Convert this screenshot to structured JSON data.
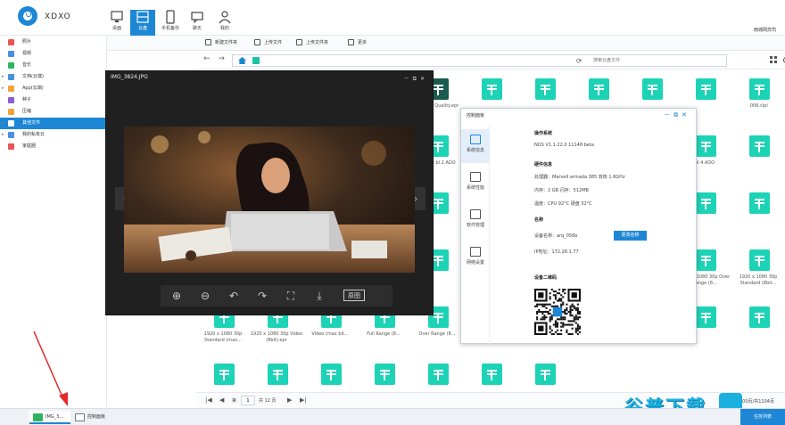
{
  "app": {
    "title": "XDXO",
    "user": "雨城网苏司"
  },
  "nav": [
    {
      "label": "桌面"
    },
    {
      "label": "云盘"
    },
    {
      "label": "手机备份"
    },
    {
      "label": "聊天"
    },
    {
      "label": "我的"
    }
  ],
  "sidebar": {
    "items": [
      {
        "label": "照片",
        "color": "#e95454",
        "arrow": ""
      },
      {
        "label": "视频",
        "color": "#4a8fe0",
        "arrow": ""
      },
      {
        "label": "音乐",
        "color": "#2fb560",
        "arrow": ""
      },
      {
        "label": "文档(云端)",
        "color": "#4a8fe0",
        "arrow": "▸"
      },
      {
        "label": "App(云端)",
        "color": "#f0a23b",
        "arrow": "▸"
      },
      {
        "label": "种子",
        "color": "#8e5cd9",
        "arrow": ""
      },
      {
        "label": "压缩",
        "color": "#f0a23b",
        "arrow": ""
      },
      {
        "label": "其他文件",
        "color": "#ffffff",
        "arrow": "▸"
      },
      {
        "label": "我的私有云",
        "color": "#4a8fe0",
        "arrow": "▸"
      },
      {
        "label": "家庭圈",
        "color": "#e95454",
        "arrow": ""
      }
    ]
  },
  "toolbar": {
    "new_folder": "新建文件夹",
    "upload_file": "上传文件",
    "upload_folder": "上传文件夹",
    "more": "更多"
  },
  "address": {
    "search_placeholder": "搜索云盘文件"
  },
  "files": [
    {
      "name": "1 High Quality.ear",
      "style": "dark"
    },
    {
      "name": "1080P.ear.m",
      "style": "dark"
    },
    {
      "name": "1080P.ear.m.epr",
      "style": "dark"
    },
    {
      "name": "1070 10 Tab.Wide.Aspe",
      "style": "dark"
    },
    {
      "name": "Medium Quality.epr",
      "style": "dark"
    },
    {
      "name": "",
      "style": "teal"
    },
    {
      "name": "",
      "style": "teal"
    },
    {
      "name": "",
      "style": "teal"
    },
    {
      "name": "",
      "style": "teal"
    },
    {
      "name": "",
      "style": "teal"
    },
    {
      "name": ".006.clpi",
      "style": "teal"
    },
    {
      "name": "",
      "style": "dark"
    },
    {
      "name": "",
      "style": "dark"
    },
    {
      "name": "",
      "style": "dark"
    },
    {
      "name": "",
      "style": "dark"
    },
    {
      "name": "orange bl 2.ADO",
      "style": "teal"
    },
    {
      "name": "",
      "style": "teal"
    },
    {
      "name": "",
      "style": "teal"
    },
    {
      "name": "",
      "style": "teal"
    },
    {
      "name": "",
      "style": "teal"
    },
    {
      "name": "bl 4.ADO",
      "style": "teal"
    },
    {
      "name": "",
      "style": "teal"
    },
    {
      "name": "",
      "style": "teal"
    },
    {
      "name": "",
      "style": "teal"
    },
    {
      "name": "",
      "style": "teal"
    },
    {
      "name": "x 1080 24p Range (8bit...",
      "style": "teal"
    },
    {
      "name": "",
      "style": "teal"
    },
    {
      "name": "",
      "style": "teal"
    },
    {
      "name": "",
      "style": "teal"
    },
    {
      "name": "",
      "style": "teal"
    },
    {
      "name": "1080 24p max bit...",
      "style": "teal"
    },
    {
      "name": "",
      "style": "teal"
    },
    {
      "name": "",
      "style": "teal"
    },
    {
      "name": "",
      "style": "teal"
    },
    {
      "name": "",
      "style": "teal"
    },
    {
      "name": "x 1080 25p Standard (8bit...",
      "style": "teal"
    },
    {
      "name": "",
      "style": "teal"
    },
    {
      "name": "",
      "style": "teal"
    },
    {
      "name": "",
      "style": "teal"
    },
    {
      "name": "",
      "style": "teal"
    },
    {
      "name": "1080 25p max bit...",
      "style": "teal"
    },
    {
      "name": "1920 x 1080 30p Over Range (8...",
      "style": "teal"
    },
    {
      "name": "1920 x 1080 30p Over Range (8...",
      "style": "teal"
    },
    {
      "name": "1920 x 1080 30p Standard (8bit...",
      "style": "teal"
    },
    {
      "name": "1920 x 1080 30p Standard (max...",
      "style": "teal"
    },
    {
      "name": "1920 x 1080 30p Video (8bit).epr",
      "style": "teal"
    },
    {
      "name": "Video (max bit...",
      "style": "teal"
    },
    {
      "name": "Full Range (8...",
      "style": "teal"
    },
    {
      "name": "Over Range (8...",
      "style": "teal"
    },
    {
      "name": "Standard (max...",
      "style": "teal"
    },
    {
      "name": "Video (max bit...",
      "style": "teal"
    },
    {
      "name": "x 1152 24p max bit...",
      "style": "teal"
    },
    {
      "name": "",
      "style": "teal"
    },
    {
      "name": "",
      "style": "teal"
    },
    {
      "name": "",
      "style": "teal"
    },
    {
      "name": "",
      "style": "teal"
    },
    {
      "name": "",
      "style": "teal"
    },
    {
      "name": "",
      "style": "teal"
    },
    {
      "name": "",
      "style": "teal"
    },
    {
      "name": "",
      "style": "teal"
    },
    {
      "name": "",
      "style": "teal"
    },
    {
      "name": "",
      "style": "teal"
    }
  ],
  "pager": {
    "current": "1",
    "page_prefix": "第",
    "page_suffix": "共 12 页",
    "count": "100页/共1104页"
  },
  "taskbar": {
    "tasks": [
      {
        "label": "IMG_3..."
      },
      {
        "label": "控制面板"
      }
    ],
    "tray": "任务列表"
  },
  "viewer": {
    "title": "IMG_3824.JPG",
    "original_label": "原图"
  },
  "cpanel": {
    "title": "控制面板",
    "tabs": [
      {
        "label": "系统信息"
      },
      {
        "label": "系统性能"
      },
      {
        "label": "软件管理"
      },
      {
        "label": "网络设置"
      }
    ],
    "os_heading": "操作系统",
    "os_value": "NOS V1.1.22.0 11148 beta",
    "hw_heading": "硬件信息",
    "cpu": "处理器：Marvell armada 385 双核 1.6GHz",
    "mem": "内存：2 GB 闪存：512MB",
    "temp": "温度：CPU 92°C 硬盘 32°C",
    "name_heading": "名称",
    "device_name": "设备名称：arq_056b",
    "rename_button": "更改名称",
    "ip": "IP地址：172.28.1.77",
    "qr_heading": "设备二维码"
  },
  "watermark": {
    "text": "谷普下载"
  }
}
